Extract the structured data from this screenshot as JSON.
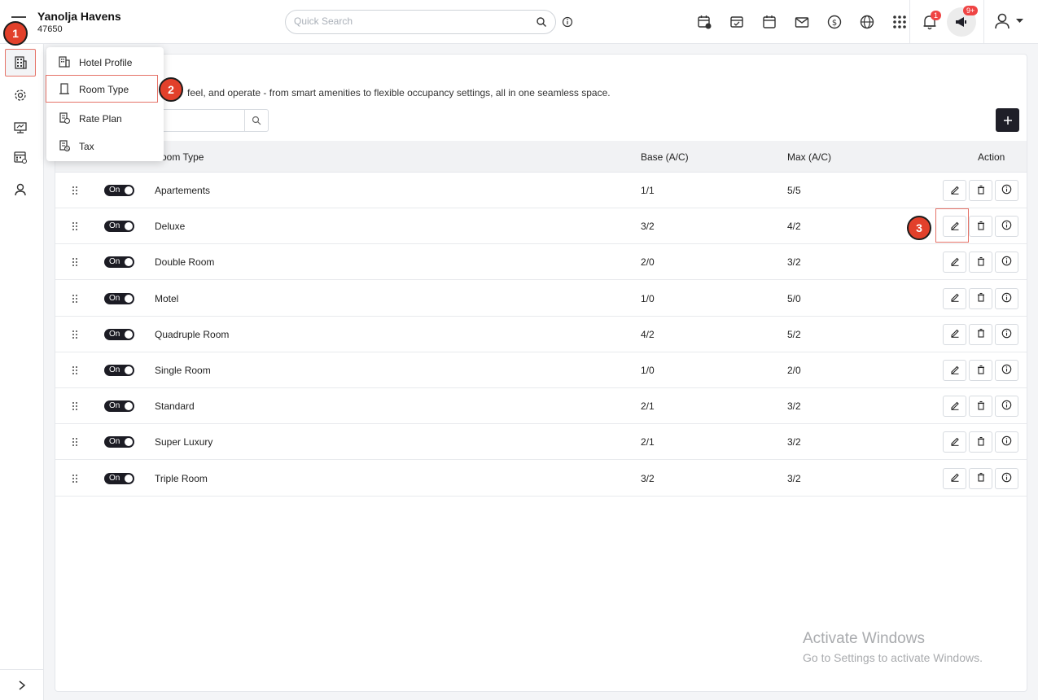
{
  "header": {
    "hotel_name": "Yanolja Havens",
    "hotel_id": "47650",
    "search_placeholder": "Quick Search",
    "notification_count": "1",
    "announcement_count": "9+"
  },
  "menu": {
    "items": [
      {
        "label": "Hotel Profile",
        "icon": "building-icon"
      },
      {
        "label": "Room Type",
        "icon": "door-icon"
      },
      {
        "label": "Rate Plan",
        "icon": "rate-icon"
      },
      {
        "label": "Tax",
        "icon": "tax-icon"
      }
    ]
  },
  "page": {
    "description": "feel, and operate - from smart amenities to flexible occupancy settings, all in one seamless space."
  },
  "table": {
    "headers": {
      "room_type": "oom Type",
      "base": "Base (A/C)",
      "max": "Max (A/C)",
      "action": "Action"
    },
    "toggle_label": "On",
    "rows": [
      {
        "name": "Apartements",
        "base": "1/1",
        "max": "5/5"
      },
      {
        "name": "Deluxe",
        "base": "3/2",
        "max": "4/2"
      },
      {
        "name": "Double Room",
        "base": "2/0",
        "max": "3/2"
      },
      {
        "name": "Motel",
        "base": "1/0",
        "max": "5/0"
      },
      {
        "name": "Quadruple Room",
        "base": "4/2",
        "max": "5/2"
      },
      {
        "name": "Single Room",
        "base": "1/0",
        "max": "2/0"
      },
      {
        "name": "Standard",
        "base": "2/1",
        "max": "3/2"
      },
      {
        "name": "Super Luxury",
        "base": "2/1",
        "max": "3/2"
      },
      {
        "name": "Triple Room",
        "base": "3/2",
        "max": "3/2"
      }
    ]
  },
  "steps": {
    "one": "1",
    "two": "2",
    "three": "3"
  },
  "watermark": {
    "line1": "Activate Windows",
    "line2": "Go to Settings to activate Windows."
  },
  "colors": {
    "accent": "#e2402b",
    "highlight": "#e57368",
    "dark": "#1f1f28"
  }
}
